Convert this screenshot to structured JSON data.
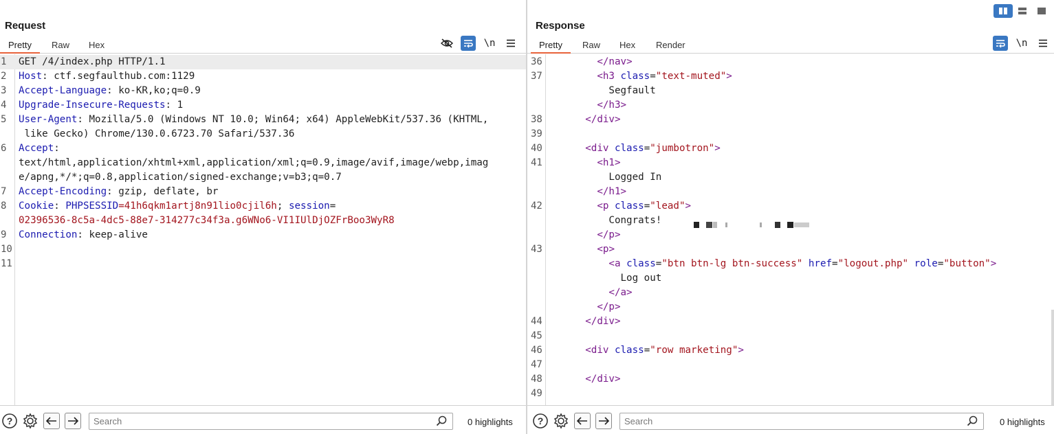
{
  "request": {
    "title": "Request",
    "tabs": [
      "Pretty",
      "Raw",
      "Hex"
    ],
    "active_tab": "Pretty",
    "tools": {
      "hide_icon": "eye-off-icon",
      "wrap_icon": "wrap-icon",
      "newline_label": "\\n",
      "menu_icon": "hamburger-menu-icon"
    },
    "lines": [
      {
        "n": "1",
        "key": "GET /4/index.php HTTP/1.1",
        "val": ""
      },
      {
        "n": "2",
        "key": "Host",
        "val": ": ctf.segfaulthub.com:1129"
      },
      {
        "n": "3",
        "key": "Accept-Language",
        "val": ": ko-KR,ko;q=0.9"
      },
      {
        "n": "4",
        "key": "Upgrade-Insecure-Requests",
        "val": ": 1"
      },
      {
        "n": "5",
        "key": "User-Agent",
        "val": ": Mozilla/5.0 (Windows NT 10.0; Win64; x64) AppleWebKit/537.36 (KHTML,"
      },
      {
        "n": "",
        "key": "",
        "val": " like Gecko) Chrome/130.0.6723.70 Safari/537.36"
      },
      {
        "n": "6",
        "key": "Accept",
        "val": ":"
      },
      {
        "n": "",
        "key": "",
        "val": "text/html,application/xhtml+xml,application/xml;q=0.9,image/avif,image/webp,imag"
      },
      {
        "n": "",
        "key": "",
        "val": "e/apng,*/*;q=0.8,application/signed-exchange;v=b3;q=0.7"
      },
      {
        "n": "7",
        "key": "Accept-Encoding",
        "val": ": gzip, deflate, br"
      },
      {
        "n": "8",
        "key": "Cookie",
        "val": ": "
      },
      {
        "n": "",
        "key": "",
        "val": ""
      },
      {
        "n": "9",
        "key": "Connection",
        "val": ": keep-alive"
      },
      {
        "n": "10",
        "key": "",
        "val": ""
      },
      {
        "n": "11",
        "key": "",
        "val": ""
      }
    ],
    "cookie": {
      "name1": "PHPSESSID",
      "value1": "=41h6qkm1artj8n91lio0cjil6h",
      "sep": "; ",
      "name2": "session",
      "eq2": "=",
      "value2": "02396536-8c5a-4dc5-88e7-314277c34f3a.g6WNo6-VI1IUlDjOZFrBoo3WyR8"
    },
    "search": {
      "placeholder": "Search",
      "value": ""
    },
    "highlights": "0 highlights"
  },
  "response": {
    "title": "Response",
    "tabs": [
      "Pretty",
      "Raw",
      "Hex",
      "Render"
    ],
    "active_tab": "Pretty",
    "tools": {
      "wrap_icon": "wrap-icon",
      "newline_label": "\\n",
      "menu_icon": "hamburger-menu-icon"
    },
    "lines": [
      {
        "n": "36",
        "indent": "        ",
        "t": "</nav>"
      },
      {
        "n": "37",
        "indent": "        ",
        "t": "<h3 class=\"text-muted\">"
      },
      {
        "n": "",
        "indent": "          ",
        "t": "Segfault"
      },
      {
        "n": "",
        "indent": "        ",
        "t": "</h3>"
      },
      {
        "n": "38",
        "indent": "      ",
        "t": "</div>"
      },
      {
        "n": "39",
        "indent": "",
        "t": ""
      },
      {
        "n": "40",
        "indent": "      ",
        "t": "<div class=\"jumbotron\">"
      },
      {
        "n": "41",
        "indent": "        ",
        "t": "<h1>"
      },
      {
        "n": "",
        "indent": "          ",
        "t": "Logged In"
      },
      {
        "n": "",
        "indent": "        ",
        "t": "</h1>"
      },
      {
        "n": "42",
        "indent": "        ",
        "t": "<p class=\"lead\">"
      },
      {
        "n": "",
        "indent": "          ",
        "t": "Congrats!"
      },
      {
        "n": "",
        "indent": "        ",
        "t": "</p>"
      },
      {
        "n": "43",
        "indent": "        ",
        "t": "<p>"
      },
      {
        "n": "",
        "indent": "          ",
        "t": "<a class=\"btn btn-lg btn-success\" href=\"logout.php\" role=\"button\">"
      },
      {
        "n": "",
        "indent": "            ",
        "t": "Log out"
      },
      {
        "n": "",
        "indent": "          ",
        "t": "</a>"
      },
      {
        "n": "",
        "indent": "        ",
        "t": "</p>"
      },
      {
        "n": "44",
        "indent": "      ",
        "t": "</div>"
      },
      {
        "n": "45",
        "indent": "",
        "t": ""
      },
      {
        "n": "46",
        "indent": "      ",
        "t": "<div class=\"row marketing\">"
      },
      {
        "n": "47",
        "indent": "",
        "t": ""
      },
      {
        "n": "48",
        "indent": "      ",
        "t": "</div>"
      },
      {
        "n": "49",
        "indent": "",
        "t": ""
      }
    ],
    "search": {
      "placeholder": "Search",
      "value": ""
    },
    "highlights": "0 highlights"
  },
  "layout_buttons": [
    {
      "icon": "columns-layout-icon",
      "active": true
    },
    {
      "icon": "rows-layout-icon",
      "active": false
    },
    {
      "icon": "single-pane-layout-icon",
      "active": false
    }
  ],
  "colors": {
    "accent": "#e8623a",
    "toggle_on": "#3a78c2",
    "header_key": "#1b1bb0",
    "value_red": "#a3151e",
    "tag_purple": "#7a1b8c"
  }
}
